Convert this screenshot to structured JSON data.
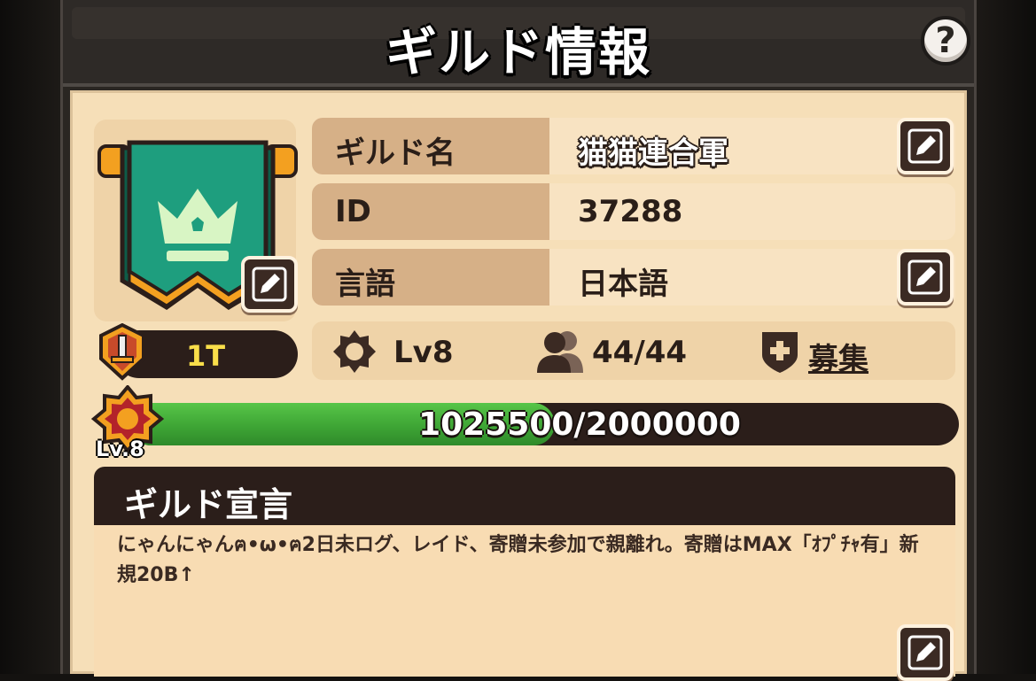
{
  "header": {
    "title": "ギルド情報",
    "help_label": "?"
  },
  "guild": {
    "name_label": "ギルド名",
    "name": "猫猫連合軍",
    "id_label": "ID",
    "id": "37288",
    "language_label": "言語",
    "language": "日本語",
    "rank": "1T"
  },
  "stats": {
    "level": "Lv8",
    "members": "44/44",
    "recruit": "募集"
  },
  "experience": {
    "text": "1025500/2000000",
    "current": 1025500,
    "max": 2000000,
    "level_label": "Lv.8"
  },
  "declaration": {
    "title": "ギルド宣言",
    "text": "にゃんにゃんฅ•ω•ฅ2日未ログ、レイド、寄贈未参加で親離れ。寄贈はMAX「ｵﾌﾟﾁｬ有」新規20B↑"
  },
  "colors": {
    "banner_green": "#1e9e7e",
    "xp_green": "#3ea535",
    "rank_yellow": "#f9de4a",
    "panel_bg": "#f6dfb8"
  }
}
